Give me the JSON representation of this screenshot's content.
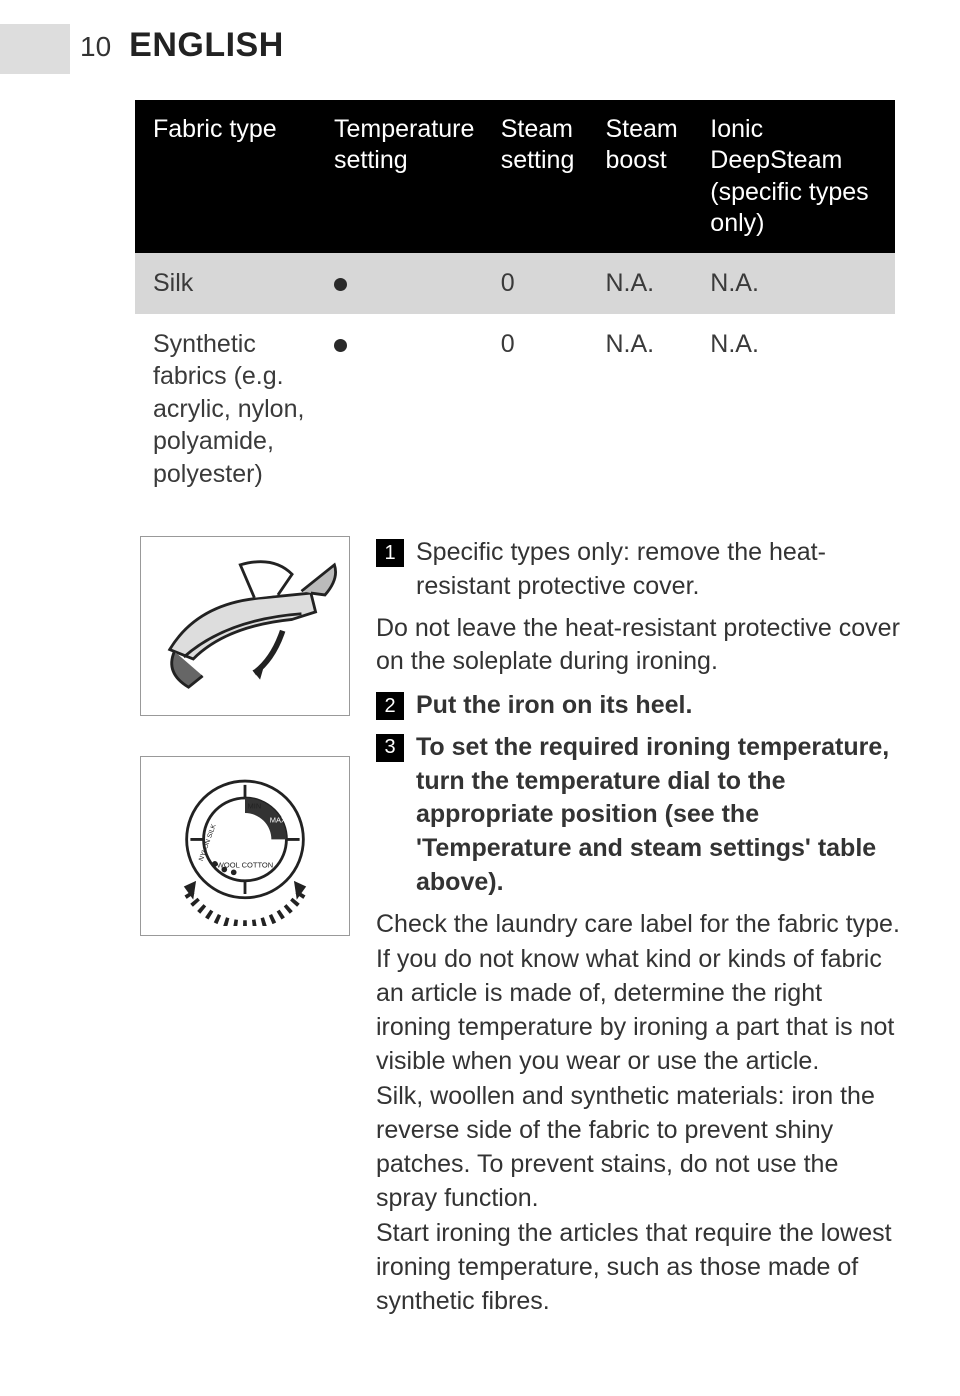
{
  "page": {
    "number": "10",
    "language": "ENGLISH"
  },
  "table": {
    "headers": {
      "fabric": "Fabric type",
      "temp": "Temperature setting",
      "steam": "Steam setting",
      "boost": "Steam boost",
      "ionic": "Ionic DeepSteam (specific types only)"
    },
    "rows": [
      {
        "fabric": "Silk",
        "steam": "0",
        "boost": "N.A.",
        "ionic": "N.A."
      },
      {
        "fabric": "Synthetic fabrics (e.g. acrylic, nylon, polyamide, polyester)",
        "steam": "0",
        "boost": "N.A.",
        "ionic": "N.A."
      }
    ]
  },
  "steps": {
    "s1": "Specific types only: remove the heat-resistant protective cover.",
    "warn": "Do not leave the heat-resistant protective cover on the soleplate during ironing.",
    "s2": "Put the iron on its heel.",
    "s3": "To set the required ironing temperature, turn the temperature dial to the appropriate position (see the 'Temperature and steam settings' table above).",
    "p1": "Check the laundry care label for the fabric type.",
    "p2": "If you do not know what kind or kinds of fabric an article is made of, determine the right ironing temperature by ironing a part that is not visible when you wear or use the article.",
    "p3": "Silk, woollen and synthetic materials: iron the reverse side of the fabric to prevent shiny patches. To prevent stains, do not use the spray function.",
    "p4": "Start ironing the articles that require the lowest ironing temperature, such as those made of synthetic fibres."
  }
}
